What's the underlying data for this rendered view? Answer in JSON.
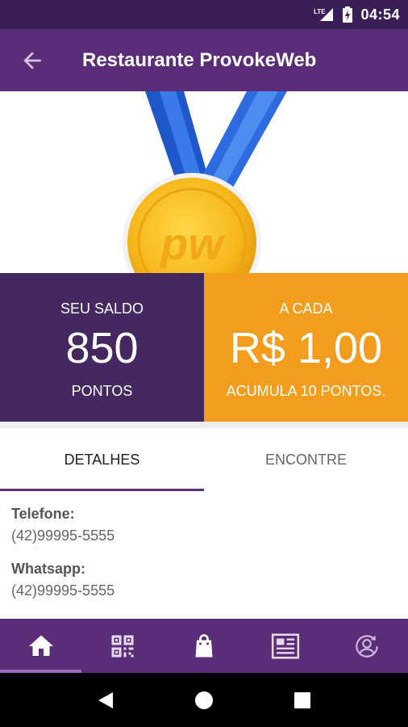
{
  "status_bar": {
    "network": "LTE",
    "time": "04:54"
  },
  "app_bar": {
    "title": "Restaurante ProvokeWeb",
    "back_icon": "arrow-back-icon"
  },
  "hero": {
    "image": "medal-icon",
    "badge_text": "pw"
  },
  "balance": {
    "label": "SEU SALDO",
    "value": "850",
    "unit": "PONTOS"
  },
  "rate": {
    "label": "A CADA",
    "value": "R$ 1,00",
    "sub": "ACUMULA 10 PONTOS."
  },
  "tabs": [
    {
      "label": "DETALHES",
      "active": true
    },
    {
      "label": "ENCONTRE",
      "active": false
    }
  ],
  "details": [
    {
      "label": "Telefone:",
      "value": "(42)99995-5555"
    },
    {
      "label": "Whatsapp:",
      "value": "(42)99995-5555"
    }
  ],
  "bottom_nav": [
    {
      "icon": "home-icon",
      "active": true
    },
    {
      "icon": "qr-code-icon",
      "active": false
    },
    {
      "icon": "shopping-bag-icon",
      "active": false
    },
    {
      "icon": "news-icon",
      "active": false
    },
    {
      "icon": "user-refresh-icon",
      "active": false
    }
  ],
  "colors": {
    "primary": "#5b2c77",
    "dark": "#44285f",
    "accent": "#f29d1d",
    "status": "#3a1f56"
  }
}
